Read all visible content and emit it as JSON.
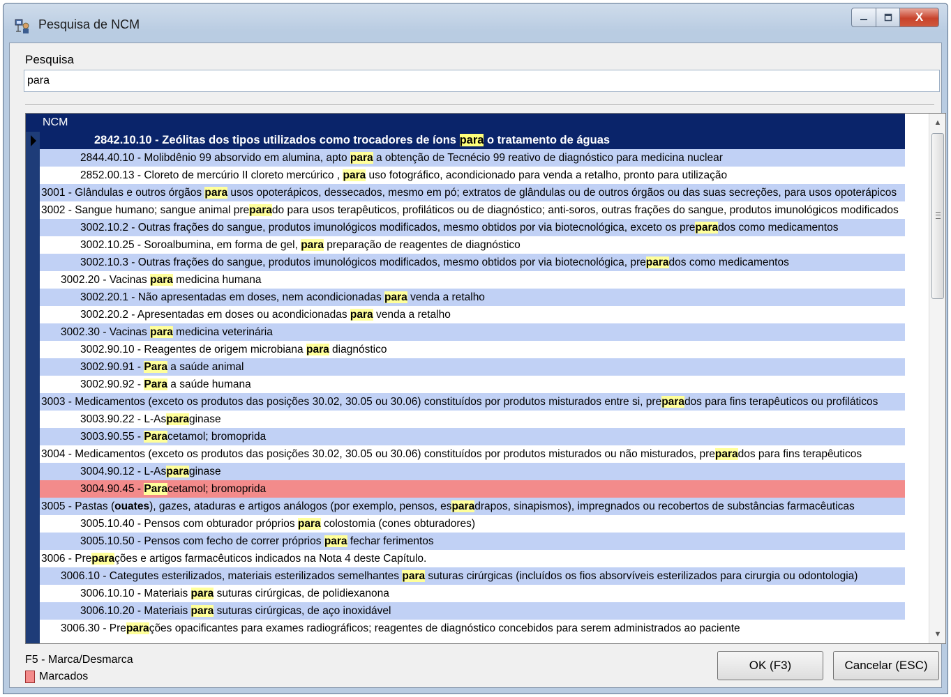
{
  "window": {
    "title": "Pesquisa de NCM",
    "controls": [
      "minimize",
      "maximize",
      "close"
    ],
    "close_glyph": "X"
  },
  "search": {
    "label": "Pesquisa",
    "value": "para"
  },
  "grid": {
    "column_header": "NCM",
    "rows": [
      {
        "indent": 3,
        "state": "selected",
        "parts": [
          [
            "2842.10.10 - Zeólitas dos tipos utilizados como trocadores de íons ",
            0
          ],
          [
            "para",
            1
          ],
          [
            " o tratamento de águas",
            0
          ]
        ]
      },
      {
        "indent": 2,
        "state": "",
        "parts": [
          [
            "2844.40.10 - Molibdênio 99 absorvido em alumina, apto ",
            0
          ],
          [
            "para",
            1
          ],
          [
            " a obtenção de Tecnécio 99  reativo de diagnóstico para medicina nuclear",
            0
          ]
        ]
      },
      {
        "indent": 2,
        "state": "",
        "parts": [
          [
            "2852.00.13 - Cloreto de mercúrio II  cloreto mercúrico , ",
            0
          ],
          [
            "para",
            1
          ],
          [
            " uso fotográfico, acondicionado para venda a retalho, pronto para utilização",
            0
          ]
        ]
      },
      {
        "indent": 0,
        "state": "",
        "parts": [
          [
            "3001 - Glândulas e outros órgãos ",
            0
          ],
          [
            "para",
            1
          ],
          [
            " usos opoterápicos, dessecados, mesmo em pó; extratos de glândulas ou de outros órgãos ou das suas secreções, para usos opoterápicos",
            0
          ]
        ]
      },
      {
        "indent": 0,
        "state": "",
        "parts": [
          [
            "3002 - Sangue humano; sangue animal pre",
            0
          ],
          [
            "para",
            1
          ],
          [
            "do para usos terapêuticos, profiláticos ou de diagnóstico; anti-soros, outras frações do sangue, produtos imunológicos modificados",
            0
          ]
        ]
      },
      {
        "indent": 2,
        "state": "",
        "parts": [
          [
            "3002.10.2 - Outras frações do sangue, produtos imunológicos modificados, mesmo obtidos por via biotecnológica, exceto os pre",
            0
          ],
          [
            "para",
            1
          ],
          [
            "dos como medicamentos",
            0
          ]
        ]
      },
      {
        "indent": 2,
        "state": "",
        "parts": [
          [
            "3002.10.25 - Soroalbumina, em forma de gel, ",
            0
          ],
          [
            "para",
            1
          ],
          [
            " preparação de reagentes de diagnóstico",
            0
          ]
        ]
      },
      {
        "indent": 2,
        "state": "",
        "parts": [
          [
            "3002.10.3 - Outras frações do sangue, produtos imunológicos modificados, mesmo obtidos por via biotecnológica, pre",
            0
          ],
          [
            "para",
            1
          ],
          [
            "dos como medicamentos",
            0
          ]
        ]
      },
      {
        "indent": 1,
        "state": "",
        "parts": [
          [
            "3002.20 - Vacinas ",
            0
          ],
          [
            "para",
            1
          ],
          [
            " medicina humana",
            0
          ]
        ]
      },
      {
        "indent": 2,
        "state": "",
        "parts": [
          [
            "3002.20.1 - Não apresentadas em doses, nem acondicionadas ",
            0
          ],
          [
            "para",
            1
          ],
          [
            " venda a retalho",
            0
          ]
        ]
      },
      {
        "indent": 2,
        "state": "",
        "parts": [
          [
            "3002.20.2 - Apresentadas em doses ou acondicionadas ",
            0
          ],
          [
            "para",
            1
          ],
          [
            " venda a retalho",
            0
          ]
        ]
      },
      {
        "indent": 1,
        "state": "",
        "parts": [
          [
            "3002.30 - Vacinas ",
            0
          ],
          [
            "para",
            1
          ],
          [
            " medicina veterinária",
            0
          ]
        ]
      },
      {
        "indent": 2,
        "state": "",
        "parts": [
          [
            "3002.90.10 - Reagentes de origem microbiana ",
            0
          ],
          [
            "para",
            1
          ],
          [
            " diagnóstico",
            0
          ]
        ]
      },
      {
        "indent": 2,
        "state": "",
        "parts": [
          [
            "3002.90.91 - ",
            0
          ],
          [
            "Para",
            1
          ],
          [
            " a saúde animal",
            0
          ]
        ]
      },
      {
        "indent": 2,
        "state": "",
        "parts": [
          [
            "3002.90.92 - ",
            0
          ],
          [
            "Para",
            1
          ],
          [
            " a saúde humana",
            0
          ]
        ]
      },
      {
        "indent": 0,
        "state": "",
        "parts": [
          [
            "3003 - Medicamentos (exceto os produtos das posições 30.02, 30.05 ou 30.06) constituídos por produtos misturados entre si, pre",
            0
          ],
          [
            "para",
            1
          ],
          [
            "dos para fins terapêuticos ou profiláticos",
            0
          ]
        ]
      },
      {
        "indent": 2,
        "state": "",
        "parts": [
          [
            "3003.90.22 - L-As",
            0
          ],
          [
            "para",
            1
          ],
          [
            "ginase",
            0
          ]
        ]
      },
      {
        "indent": 2,
        "state": "",
        "parts": [
          [
            "3003.90.55 - ",
            0
          ],
          [
            "Para",
            1
          ],
          [
            "cetamol; bromoprida",
            0
          ]
        ]
      },
      {
        "indent": 0,
        "state": "",
        "parts": [
          [
            "3004 - Medicamentos (exceto os produtos das posições 30.02, 30.05 ou 30.06) constituídos por produtos misturados ou não misturados, pre",
            0
          ],
          [
            "para",
            1
          ],
          [
            "dos para fins terapêuticos",
            0
          ]
        ]
      },
      {
        "indent": 2,
        "state": "",
        "parts": [
          [
            "3004.90.12 - L-As",
            0
          ],
          [
            "para",
            1
          ],
          [
            "ginase",
            0
          ]
        ]
      },
      {
        "indent": 2,
        "state": "marked",
        "parts": [
          [
            "3004.90.45 - ",
            0
          ],
          [
            "Para",
            1
          ],
          [
            "cetamol; bromoprida",
            0
          ]
        ]
      },
      {
        "indent": 0,
        "state": "",
        "parts": [
          [
            "3005 - Pastas (",
            0
          ],
          [
            "ouates",
            2
          ],
          [
            "), gazes, ataduras e artigos análogos (por exemplo, pensos, es",
            0
          ],
          [
            "para",
            1
          ],
          [
            "drapos, sinapismos), impregnados ou recobertos de substâncias farmacêuticas",
            0
          ]
        ]
      },
      {
        "indent": 2,
        "state": "",
        "parts": [
          [
            "3005.10.40 - Pensos com obturador próprios ",
            0
          ],
          [
            "para",
            1
          ],
          [
            " colostomia (cones obturadores)",
            0
          ]
        ]
      },
      {
        "indent": 2,
        "state": "",
        "parts": [
          [
            "3005.10.50 - Pensos com fecho de correr próprios ",
            0
          ],
          [
            "para",
            1
          ],
          [
            " fechar ferimentos",
            0
          ]
        ]
      },
      {
        "indent": 0,
        "state": "",
        "parts": [
          [
            "3006 - Pre",
            0
          ],
          [
            "para",
            1
          ],
          [
            "ções e artigos farmacêuticos indicados na Nota 4 deste Capítulo.",
            0
          ]
        ]
      },
      {
        "indent": 1,
        "state": "",
        "parts": [
          [
            "3006.10 - Categutes esterilizados, materiais esterilizados semelhantes ",
            0
          ],
          [
            "para",
            1
          ],
          [
            " suturas cirúrgicas (incluídos os fios absorvíveis esterilizados para cirurgia ou odontologia)",
            0
          ]
        ]
      },
      {
        "indent": 2,
        "state": "",
        "parts": [
          [
            "3006.10.10 - Materiais ",
            0
          ],
          [
            "para",
            1
          ],
          [
            " suturas cirúrgicas, de polidiexanona",
            0
          ]
        ]
      },
      {
        "indent": 2,
        "state": "",
        "parts": [
          [
            "3006.10.20 - Materiais ",
            0
          ],
          [
            "para",
            1
          ],
          [
            " suturas cirúrgicas, de aço inoxidável",
            0
          ]
        ]
      },
      {
        "indent": 1,
        "state": "",
        "parts": [
          [
            "3006.30 - Pre",
            0
          ],
          [
            "para",
            1
          ],
          [
            "ções opacificantes para exames radiográficos; reagentes de diagnóstico concebidos para serem administrados ao paciente",
            0
          ]
        ]
      }
    ]
  },
  "footer": {
    "hint": "F5 - Marca/Desmarca",
    "legend_label": "Marcados",
    "legend_color": "#f38b8b",
    "ok_label": "OK (F3)",
    "cancel_label": "Cancelar (ESC)"
  },
  "colors": {
    "header_bg": "#0a246a",
    "row_alt": "#c1d1f5",
    "highlight": "#ffff9a",
    "marked": "#f38b8b"
  }
}
